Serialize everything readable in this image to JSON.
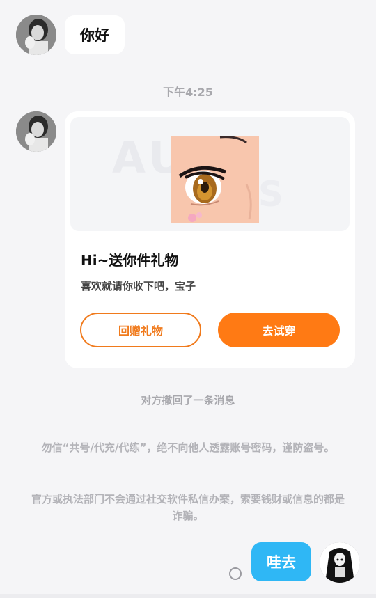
{
  "messages": {
    "greeting": "你好",
    "timestamp": "下午4:25",
    "gift_card": {
      "title": "Hi~送你件礼物",
      "subtitle": "喜欢就请你收下吧，宝子",
      "return_gift_label": "回赠礼物",
      "try_on_label": "去试穿"
    },
    "recall_notice": "对方撤回了一条消息",
    "warning_1": "勿信“共号/代充/代练”，绝不向他人透露账号密码，谨防盗号。",
    "warning_2": "官方或执法部门不会通过社交软件私信办案，索要钱财或信息的都是诈骗。",
    "reply": "哇去"
  },
  "colors": {
    "accent_orange": "#ff7a14",
    "outgoing_bubble": "#2fb7f5",
    "background": "#f5f5f7"
  },
  "icons": {
    "sent_status": "status-circle-icon"
  }
}
